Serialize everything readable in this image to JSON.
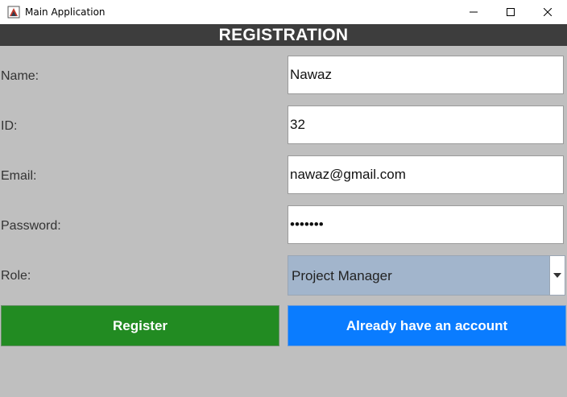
{
  "window": {
    "title": "Main Application",
    "controls": [
      "minimize-icon",
      "maximize-icon",
      "close-icon"
    ]
  },
  "header": {
    "title": "REGISTRATION"
  },
  "form": {
    "name_label": "Name:",
    "name_value": "Nawaz",
    "id_label": "ID:",
    "id_value": "32",
    "email_label": "Email:",
    "email_value": "nawaz@gmail.com",
    "password_label": "Password:",
    "password_value": "•••••••",
    "role_label": "Role:",
    "role_value": "Project Manager"
  },
  "buttons": {
    "register_label": "Register",
    "login_label": "Already have an account"
  },
  "colors": {
    "header_bg": "#3d3d3d",
    "background": "#bfbfbf",
    "register_bg": "#228b22",
    "login_bg": "#0a7cff",
    "select_bg": "#a2b5cc"
  }
}
